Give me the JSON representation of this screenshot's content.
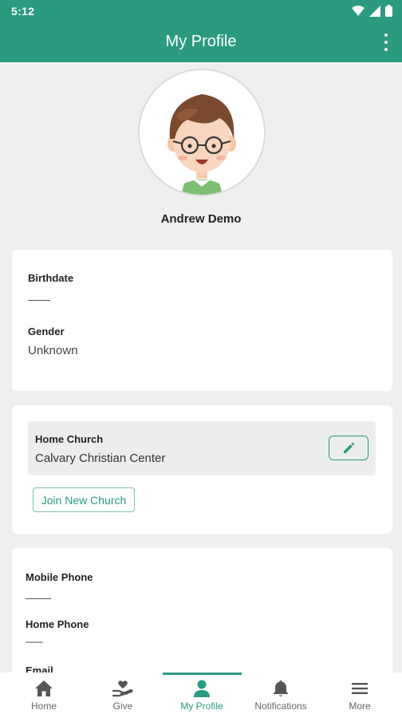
{
  "status_bar": {
    "time": "5:12"
  },
  "app_bar": {
    "title": "My Profile"
  },
  "profile": {
    "name": "Andrew Demo"
  },
  "personal": {
    "birthdate_label": "Birthdate",
    "gender_label": "Gender",
    "gender_value": "Unknown"
  },
  "church": {
    "label": "Home Church",
    "value": "Calvary Christian Center",
    "join_label": "Join New Church"
  },
  "contact": {
    "mobile_label": "Mobile Phone",
    "home_label": "Home Phone",
    "home_value": "--------",
    "email_label": "Email"
  },
  "bottom_nav": {
    "items": [
      {
        "label": "Home",
        "icon": "home-icon"
      },
      {
        "label": "Give",
        "icon": "give-icon"
      },
      {
        "label": "My Profile",
        "icon": "profile-icon",
        "active": true
      },
      {
        "label": "Notifications",
        "icon": "bell-icon"
      },
      {
        "label": "More",
        "icon": "menu-icon"
      }
    ]
  },
  "colors": {
    "accent": "#2a9a80",
    "background": "#eef0ef"
  }
}
